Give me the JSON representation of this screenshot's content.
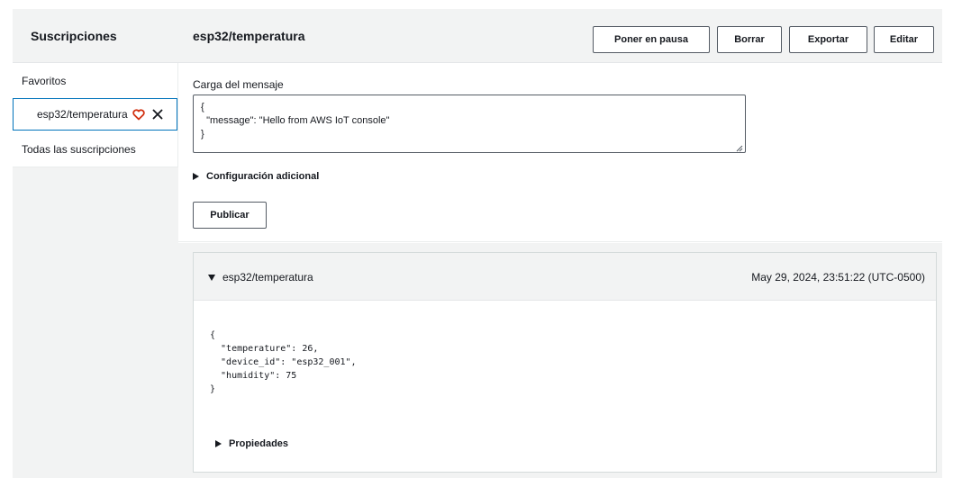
{
  "sidebar": {
    "title": "Suscripciones",
    "favorites_label": "Favoritos",
    "favorite_item": "esp32/temperatura",
    "all_subscriptions": "Todas las suscripciones"
  },
  "header": {
    "topic": "esp32/temperatura",
    "pause_label": "Poner en pausa",
    "clear_label": "Borrar",
    "export_label": "Exportar",
    "edit_label": "Editar"
  },
  "publish": {
    "payload_label": "Carga del mensaje",
    "payload_value": "{\n  \"message\": \"Hello from AWS IoT console\"\n}",
    "additional_config": "Configuración adicional",
    "publish_label": "Publicar"
  },
  "message": {
    "topic": "esp32/temperatura",
    "timestamp": "May 29, 2024, 23:51:22 (UTC-0500)",
    "body": "{\n  \"temperature\": 26,\n  \"device_id\": \"esp32_001\",\n  \"humidity\": 75\n}",
    "properties_label": "Propiedades"
  },
  "colors": {
    "heart": "#d13212",
    "border_active": "#0073bb",
    "panel_bg": "#f2f3f3"
  },
  "icons": {
    "favorite": "heart-icon",
    "remove": "close-icon",
    "expand": "caret-right-icon",
    "collapse": "caret-down-icon"
  }
}
